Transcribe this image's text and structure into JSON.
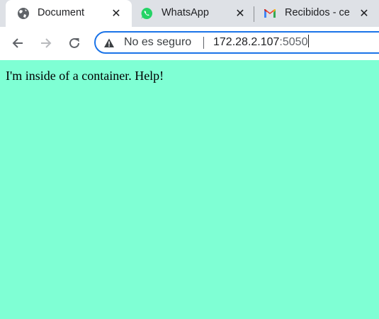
{
  "tabs": [
    {
      "title": "Document",
      "icon": "globe-icon",
      "active": true
    },
    {
      "title": "WhatsApp",
      "icon": "whatsapp-icon",
      "active": false
    },
    {
      "title": "Recibidos - ce",
      "icon": "gmail-icon",
      "active": false
    }
  ],
  "tab_close_symbol": "✕",
  "omnibox": {
    "security_label": "No es seguro",
    "url_host": "172.28.2.107",
    "url_port": ":5050"
  },
  "page": {
    "text": "I'm inside of a container. Help!",
    "background": "#7fffd4"
  },
  "colors": {
    "tabstrip": "#dee1e6",
    "omnibox_focus": "#1a73e8",
    "whatsapp": "#25d366"
  }
}
